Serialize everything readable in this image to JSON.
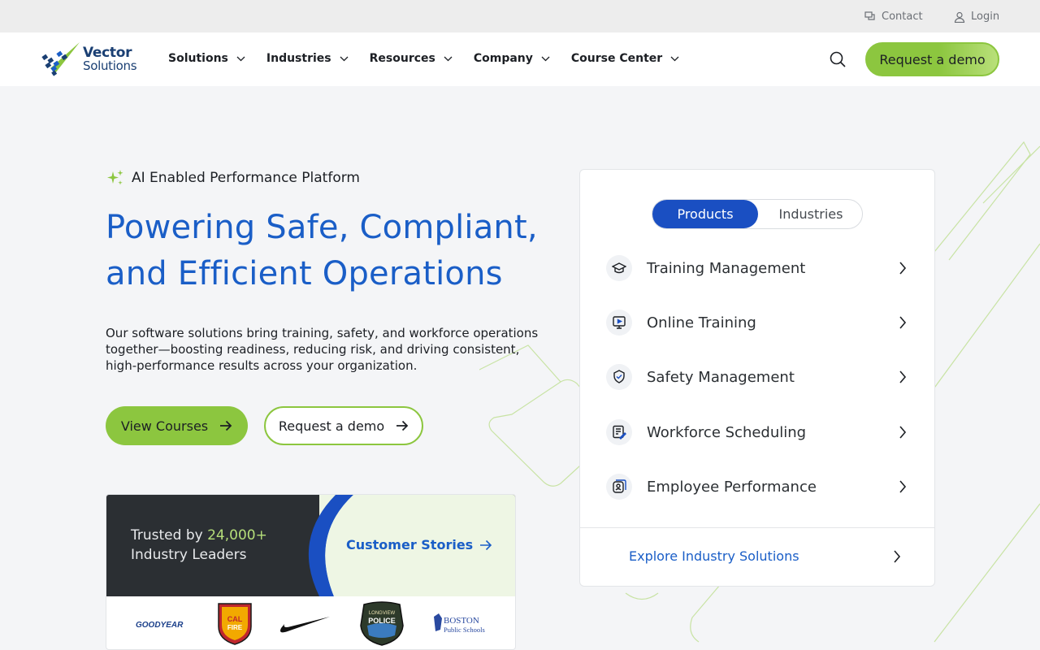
{
  "utility": {
    "contact_label": "Contact",
    "login_label": "Login"
  },
  "logo": {
    "line1": "Vector",
    "line2": "Solutions"
  },
  "nav": {
    "items": [
      {
        "label": "Solutions"
      },
      {
        "label": "Industries"
      },
      {
        "label": "Resources"
      },
      {
        "label": "Company"
      },
      {
        "label": "Course Center"
      }
    ],
    "demo_label": "Request a demo"
  },
  "hero": {
    "eyebrow": "AI Enabled Performance Platform",
    "title_line1": "Powering Safe, Compliant,",
    "title_line2": "and Efficient Operations",
    "description": "Our software solutions bring training, safety, and workforce operations together—boosting readiness, reducing risk, and driving consistent, high-performance results across your organization.",
    "view_courses_label": "View Courses",
    "request_demo_label": "Request a demo"
  },
  "trust": {
    "prefix": "Trusted by ",
    "count": "24,000+",
    "suffix": "Industry Leaders",
    "stories_label": "Customer Stories",
    "logos": [
      {
        "name": "GOODYEAR"
      },
      {
        "name": "CAL FIRE"
      },
      {
        "name": "Nike"
      },
      {
        "name": "LONGVIEW POLICE"
      },
      {
        "name": "BOSTON Public Schools"
      }
    ]
  },
  "panel": {
    "tabs": [
      {
        "label": "Products",
        "active": true
      },
      {
        "label": "Industries",
        "active": false
      }
    ],
    "products": [
      {
        "label": "Training Management",
        "icon": "graduation-cap-icon"
      },
      {
        "label": "Online Training",
        "icon": "video-play-icon"
      },
      {
        "label": "Safety Management",
        "icon": "shield-badge-icon"
      },
      {
        "label": "Workforce Scheduling",
        "icon": "schedule-edit-icon"
      },
      {
        "label": "Employee Performance",
        "icon": "employee-badge-icon"
      }
    ],
    "explore_label": "Explore Industry Solutions"
  },
  "colors": {
    "brand_blue": "#1a5ec7",
    "accent_green": "#8cc63f",
    "toggle_active": "#1a4fc2",
    "dark": "#2b2f33"
  }
}
